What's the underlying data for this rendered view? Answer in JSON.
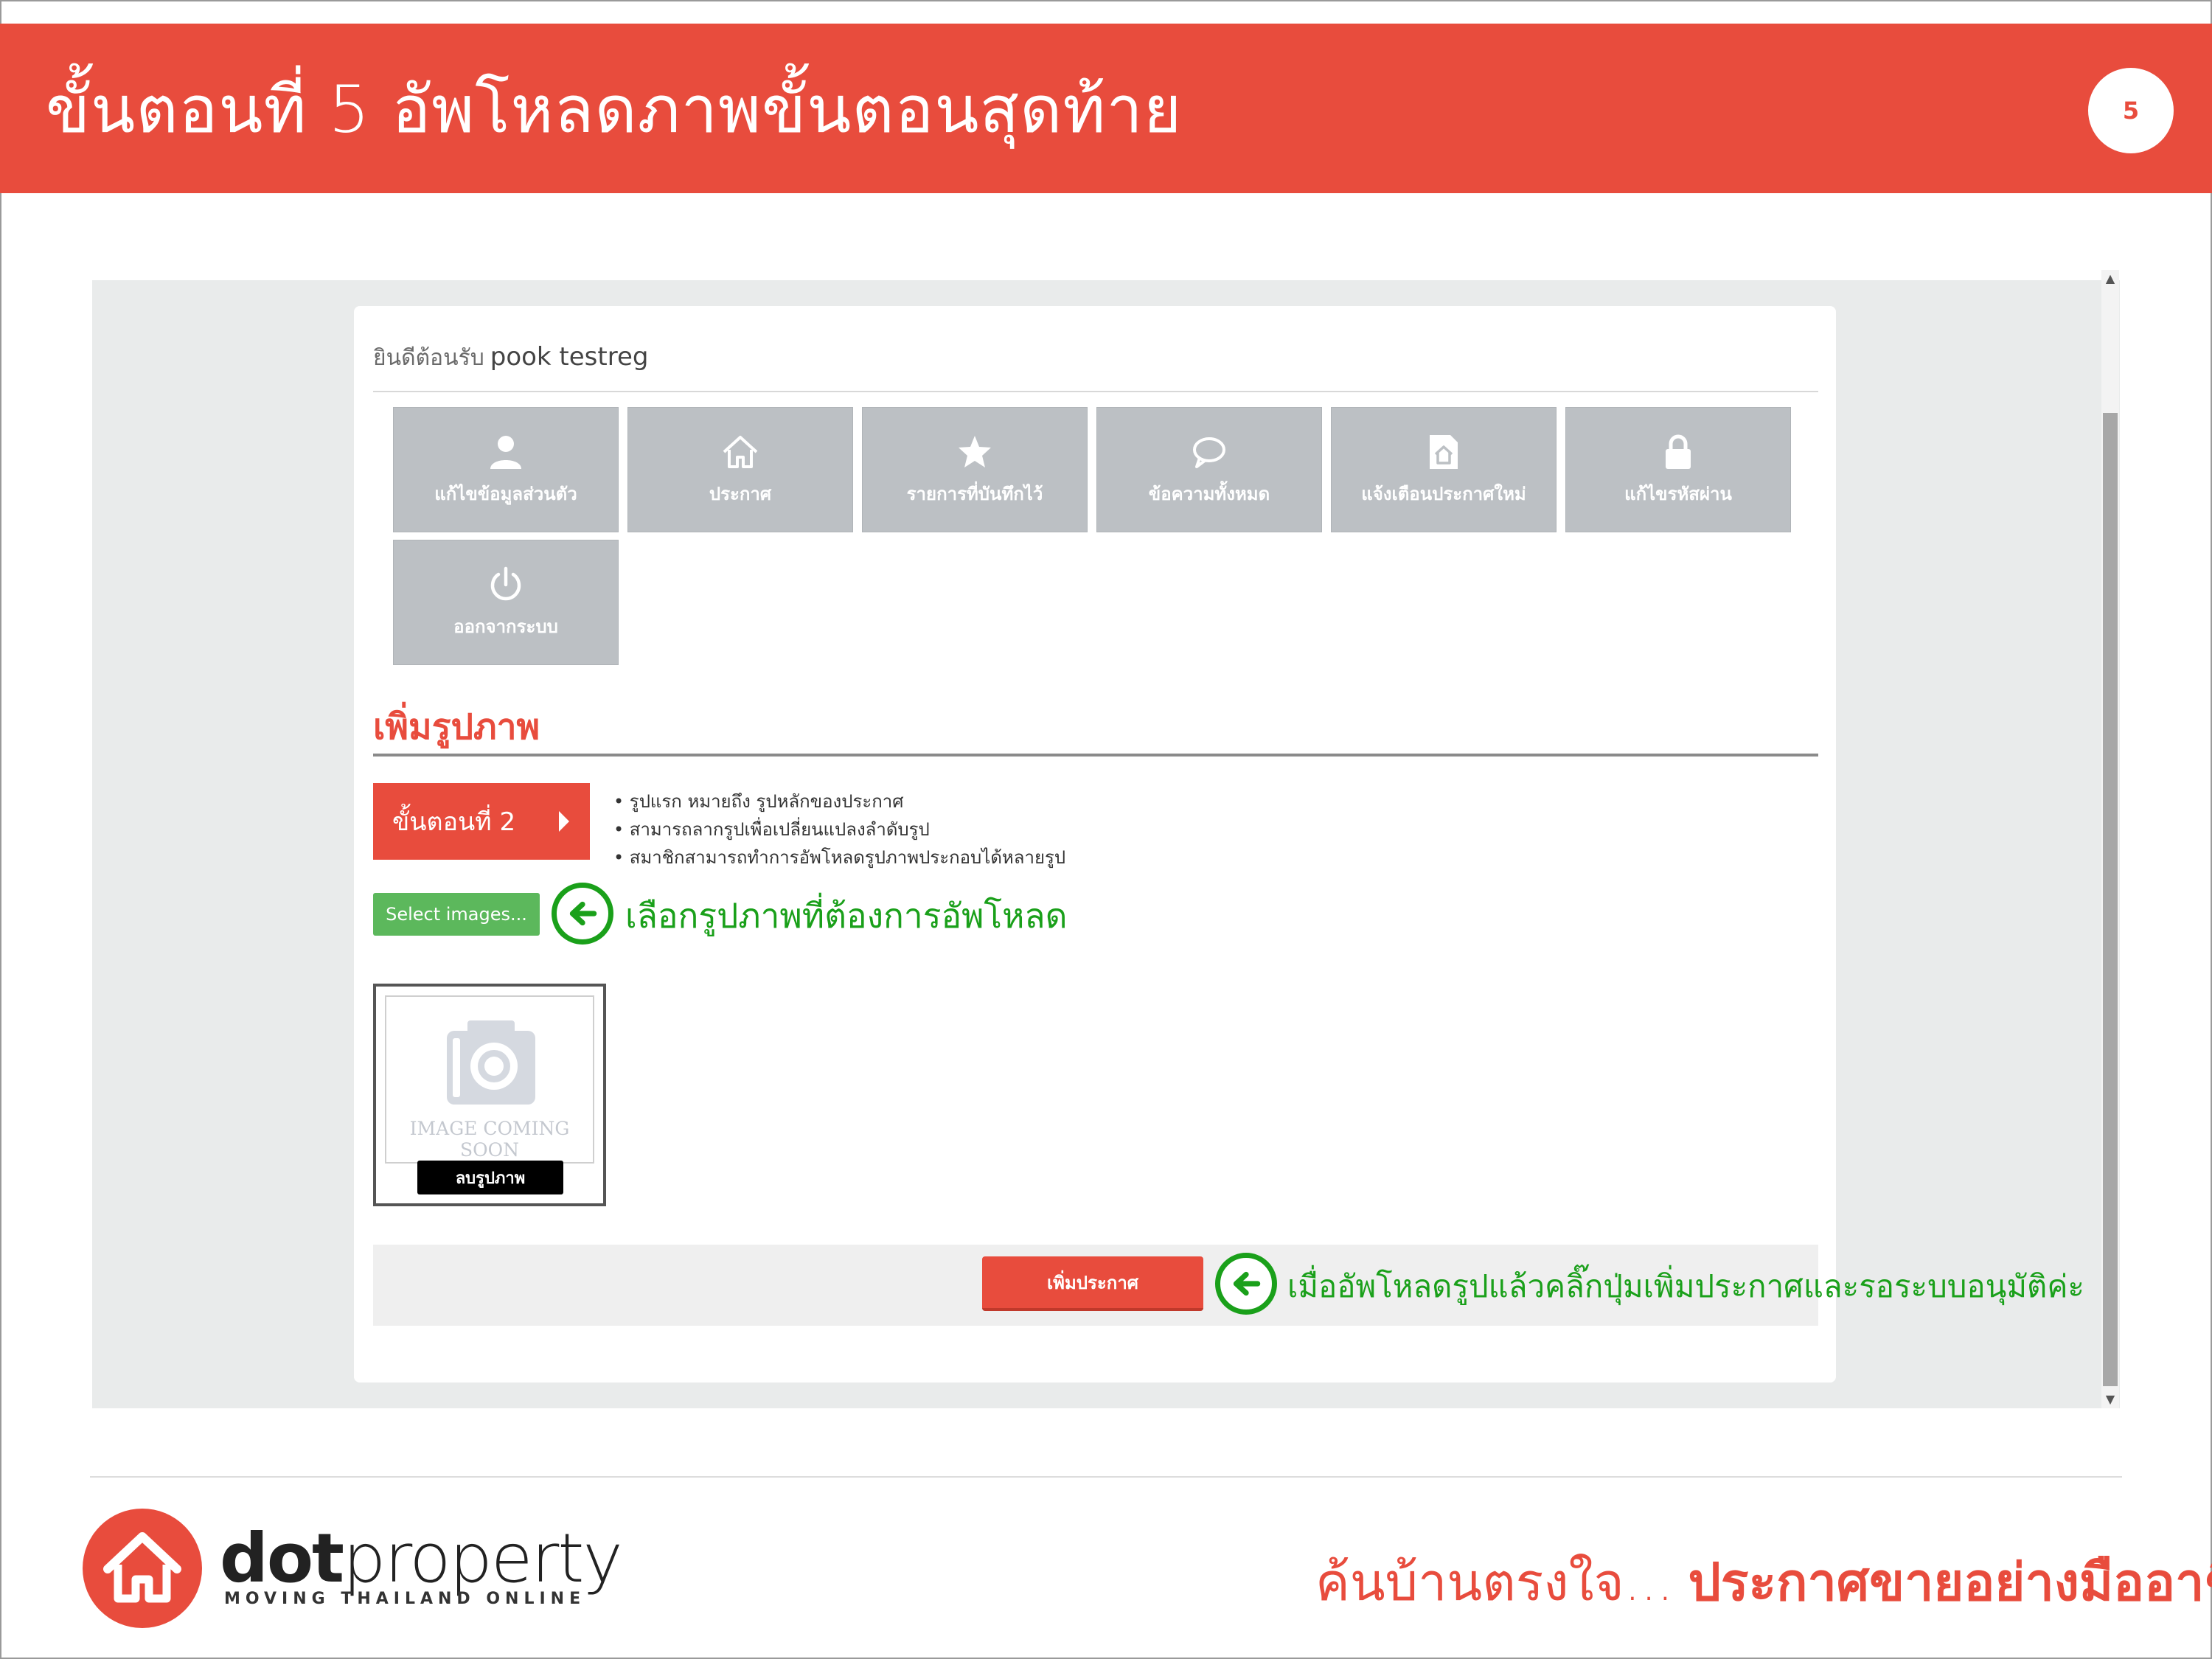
{
  "slide": {
    "title": "ขั้นตอนที่ 5 อัพโหลดภาพขั้นตอนสุดท้าย",
    "page_number": "5"
  },
  "welcome": {
    "label": "ยินดีต้อนรับ",
    "username": "pook testreg"
  },
  "menu_tiles": [
    {
      "label": "แก้ไขข้อมูลส่วนตัว",
      "icon": "user-icon"
    },
    {
      "label": "ประกาศ",
      "icon": "home-icon"
    },
    {
      "label": "รายการที่บันทึกไว้",
      "icon": "star-icon"
    },
    {
      "label": "ข้อความทั้งหมด",
      "icon": "speech-bubble-icon"
    },
    {
      "label": "แจ้งเตือนประกาศใหม่",
      "icon": "document-home-icon"
    },
    {
      "label": "แก้ไขรหัสผ่าน",
      "icon": "lock-icon"
    },
    {
      "label": "ออกจากระบบ",
      "icon": "power-icon"
    }
  ],
  "section": {
    "title": "เพิ่มรูปภาพ"
  },
  "step": {
    "label": "ขั้นตอนที่ 2"
  },
  "notes": [
    "รูปแรก หมายถึง รูปหลักของประกาศ",
    "สามารถลากรูปเพื่อเปลี่ยนแปลงลำดับรูป",
    "สมาชิกสามารถทำการอัพโหลดรูปภาพประกอบได้หลายรูป"
  ],
  "upload": {
    "select_label": "Select images...",
    "callout": "เลือกรูปภาพที่ต้องการอัพโหลด",
    "placeholder_text": "IMAGE COMING SOON",
    "delete_label": "ลบรูปภาพ"
  },
  "submit": {
    "label": "เพิ่มประกาศ",
    "callout": "เมื่ออัพโหลดรูปแล้วคลิ๊กปุ่มเพิ่มประกาศและรอระบบอนุมัติค่ะ"
  },
  "footer": {
    "brand_bold": "dot",
    "brand_light": "property",
    "brand_sub": "MOVING THAILAND ONLINE",
    "tagline_light": "ค้นบ้านตรงใจ...",
    "tagline_bold": "ประกาศขายอย่างมืออาชีพ"
  },
  "colors": {
    "brand_red": "#e84c3d",
    "callout_green": "#1aa01a",
    "tile_gray": "#bcc0c4",
    "select_green": "#5cb85c"
  }
}
